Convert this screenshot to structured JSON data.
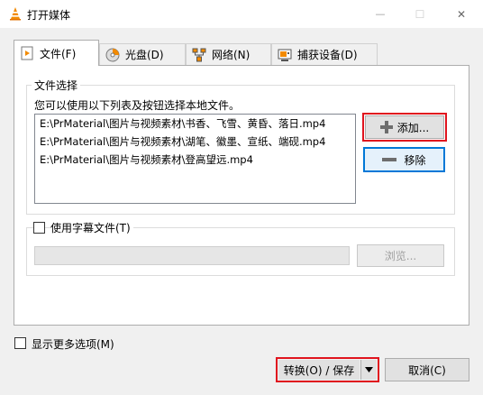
{
  "window": {
    "title": "打开媒体",
    "controls": {
      "minimize": "—",
      "maximize": "☐",
      "close": "✕"
    }
  },
  "tabs": [
    {
      "label": "文件(F)",
      "icon": "file-play-icon",
      "active": true
    },
    {
      "label": "光盘(D)",
      "icon": "disc-icon",
      "active": false
    },
    {
      "label": "网络(N)",
      "icon": "network-icon",
      "active": false
    },
    {
      "label": "捕获设备(D)",
      "icon": "capture-device-icon",
      "active": false
    }
  ],
  "file_section": {
    "title": "文件选择",
    "hint": "您可以使用以下列表及按钮选择本地文件。",
    "files": [
      "E:\\PrMaterial\\图片与视频素材\\书香、飞雪、黄昏、落日.mp4",
      "E:\\PrMaterial\\图片与视频素材\\湖笔、徽墨、宣纸、端砚.mp4",
      "E:\\PrMaterial\\图片与视频素材\\登高望远.mp4"
    ],
    "add_label": "添加...",
    "remove_label": "移除"
  },
  "subtitle_section": {
    "checkbox_label": "使用字幕文件(T)",
    "checked": false,
    "browse_label": "浏览..."
  },
  "more_options": {
    "label": "显示更多选项(M)",
    "checked": false
  },
  "footer": {
    "convert_label": "转换(O) / 保存",
    "cancel_label": "取消(C)"
  },
  "colors": {
    "highlight": "#e0141e",
    "accent": "#0078d7"
  }
}
